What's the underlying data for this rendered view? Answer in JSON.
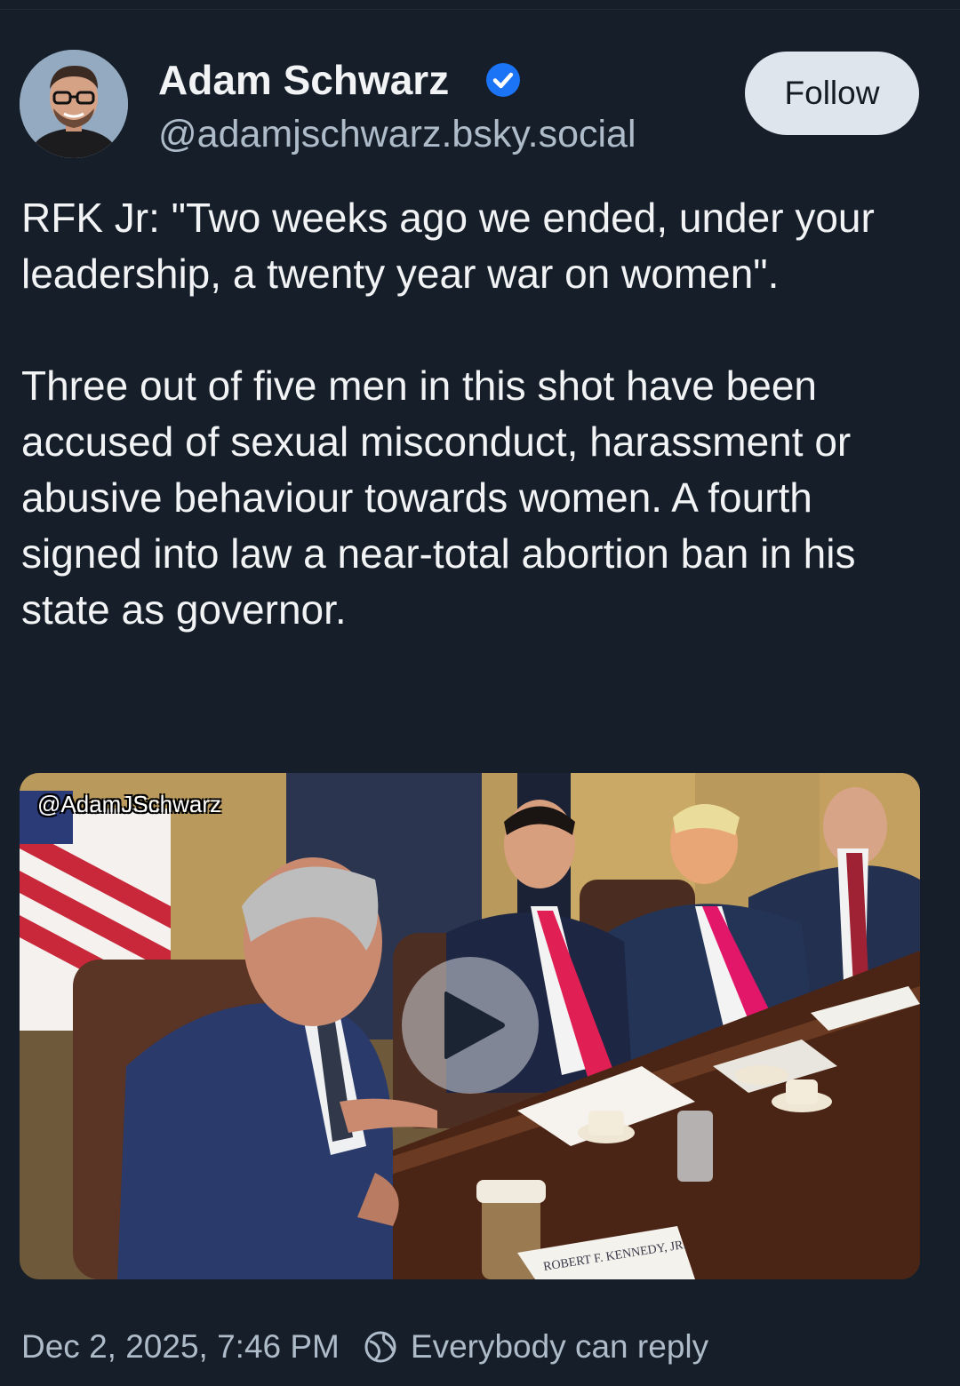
{
  "post": {
    "author": {
      "display_name": "Adam Schwarz",
      "handle": "@adamjschwarz.bsky.social",
      "verified": true,
      "avatar_icon": "person-avatar"
    },
    "follow_label": "Follow",
    "text_paragraphs": [
      "RFK Jr: \"Two weeks ago we ended, under your leadership, a twenty year war on women\".",
      "Three out of five men in this shot have been accused of sexual misconduct, harassment or abusive behaviour towards women. A fourth signed into law a near-total abortion ban in his state as governor."
    ],
    "media": {
      "type": "video",
      "watermark": "@AdamJSchwarz",
      "play_icon": "play-icon",
      "placard_text": "ROBERT F. KENNEDY, JR."
    },
    "timestamp": "Dec 2, 2025, 7:46 PM",
    "reply_setting": "Everybody can reply",
    "reply_icon": "globe-reply-icon"
  },
  "colors": {
    "background": "#161e29",
    "text_primary": "#f1f3f5",
    "text_secondary": "#aebbc9",
    "follow_button_bg": "#dfe5ec",
    "verified_blue": "#1a74f5"
  }
}
